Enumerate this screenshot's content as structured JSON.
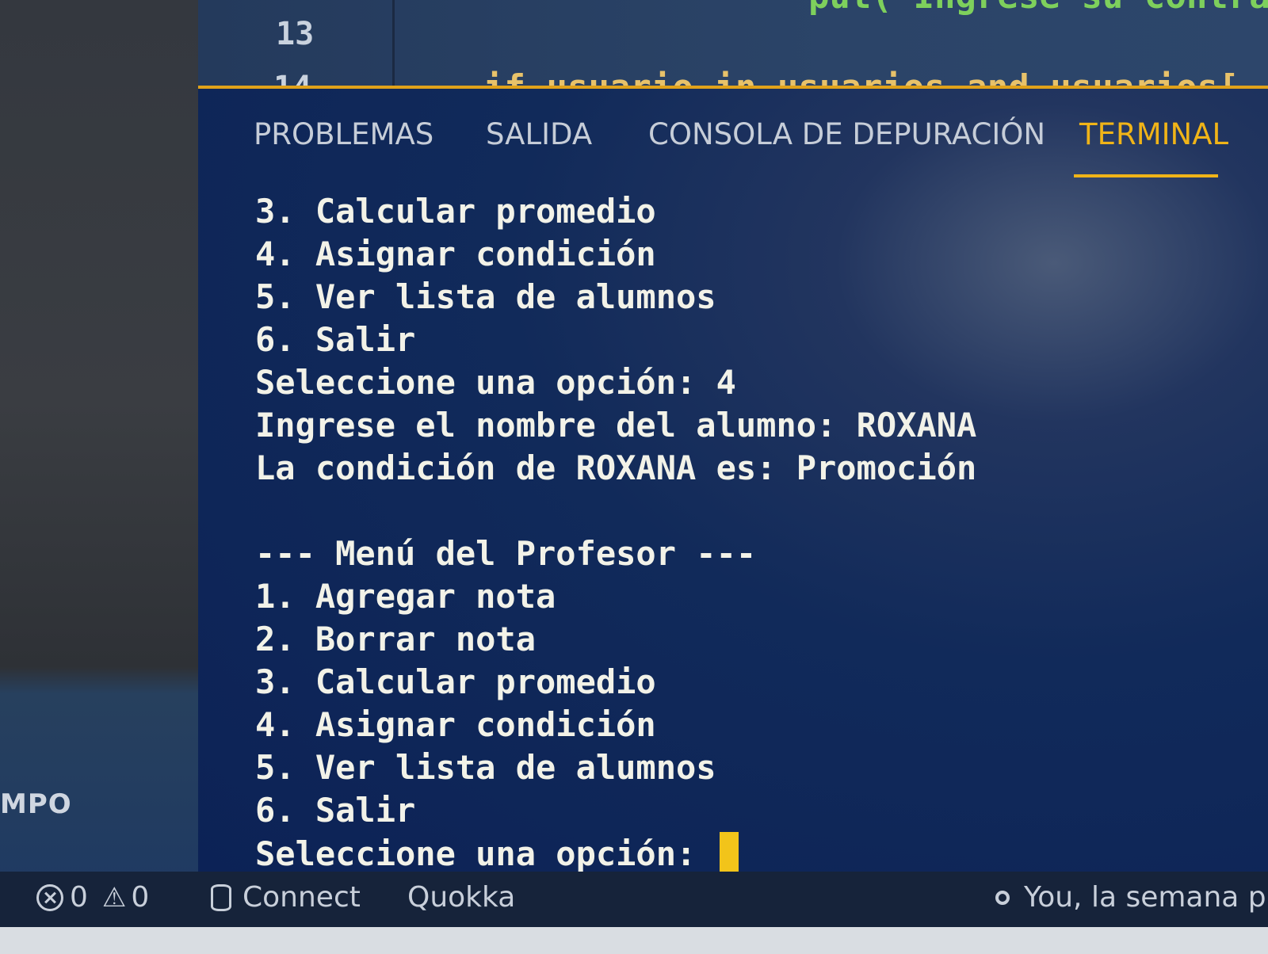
{
  "editor": {
    "line_number": "13",
    "line_number_partial": "14",
    "code_top": "put(\"Ingrese su contra",
    "code_partial": "if usuario in usuarios and usuarios["
  },
  "sidebar": {
    "label": "MPO"
  },
  "tabs": [
    {
      "label": "PROBLEMAS",
      "active": false
    },
    {
      "label": "SALIDA",
      "active": false
    },
    {
      "label": "CONSOLA DE DEPURACIÓN",
      "active": false
    },
    {
      "label": "TERMINAL",
      "active": true
    }
  ],
  "terminal": {
    "lines": [
      "3. Calcular promedio",
      "4. Asignar condición",
      "5. Ver lista de alumnos",
      "6. Salir",
      "Seleccione una opción: 4",
      "Ingrese el nombre del alumno: ROXANA",
      "La condición de ROXANA es: Promoción",
      "",
      "--- Menú del Profesor ---",
      "1. Agregar nota",
      "2. Borrar nota",
      "3. Calcular promedio",
      "4. Asignar condición",
      "5. Ver lista de alumnos",
      "6. Salir"
    ],
    "prompt": "Seleccione una opción: "
  },
  "statusbar": {
    "errors": "0",
    "warnings": "0",
    "connect": "Connect",
    "quokka": "Quokka",
    "git_blame": "You, la semana p"
  },
  "colors": {
    "accent": "#f0b418",
    "terminal_bg": "#0c2256",
    "terminal_fg": "#f2f2e8"
  }
}
